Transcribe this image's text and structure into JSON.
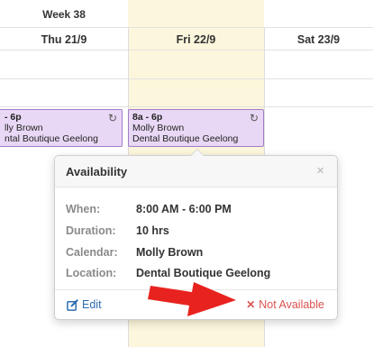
{
  "calendar": {
    "week_label": "Week 38",
    "days": [
      {
        "label": "Thu 21/9"
      },
      {
        "label": "Fri 22/9"
      },
      {
        "label": "Sat 23/9"
      }
    ]
  },
  "events": [
    {
      "time": "- 6p",
      "name": "lly Brown",
      "location": "ntal Boutique Geelong",
      "icon": "sync-icon"
    },
    {
      "time": "8a - 6p",
      "name": "Molly Brown",
      "location": "Dental Boutique Geelong",
      "icon": "sync-icon"
    }
  ],
  "popover": {
    "title": "Availability",
    "close": "×",
    "fields": [
      {
        "label": "When:",
        "value": "8:00 AM - 6:00 PM"
      },
      {
        "label": "Duration:",
        "value": "10 hrs"
      },
      {
        "label": "Calendar:",
        "value": "Molly Brown"
      },
      {
        "label": "Location:",
        "value": "Dental Boutique Geelong"
      }
    ],
    "edit_label": "Edit",
    "not_available_label": "Not Available"
  },
  "colors": {
    "today_bg": "#fcf6dc",
    "event_bg": "#e8d8f5",
    "event_border": "#a37cc8",
    "link_blue": "#2b6cb0",
    "danger_red": "#d9534f",
    "annotation_arrow": "#e8231f"
  }
}
